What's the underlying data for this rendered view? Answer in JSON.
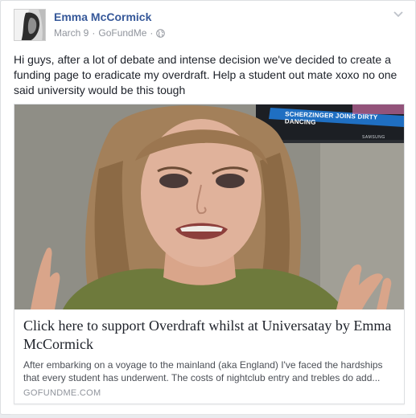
{
  "post": {
    "author": "Emma McCormick",
    "date": "March 9",
    "separator": "·",
    "source": "GoFundMe",
    "separator2": "·",
    "privacy_icon": "globe-icon",
    "menu_icon": "chevron-down-icon",
    "text": "Hi guys, after a lot of debate and intense decision we've decided to create a funding page to eradicate my overdraft. Help a student out mate xoxo no one said university would be this tough"
  },
  "link": {
    "image_caption": "SCHERZINGER JOINS DIRTY DANCING",
    "image_brand": "SAMSUNG",
    "title": "Click here to support Overdraft whilst at Universatay by Emma McCormick",
    "description": "After embarking on a voyage to the mainland (aka England) I've faced the hardships that every student has underwent. The costs of nightclub entry and trebles do add...",
    "domain": "GOFUNDME.COM"
  },
  "colors": {
    "link_blue": "#365899",
    "meta_gray": "#90949c",
    "text": "#1d2129"
  }
}
